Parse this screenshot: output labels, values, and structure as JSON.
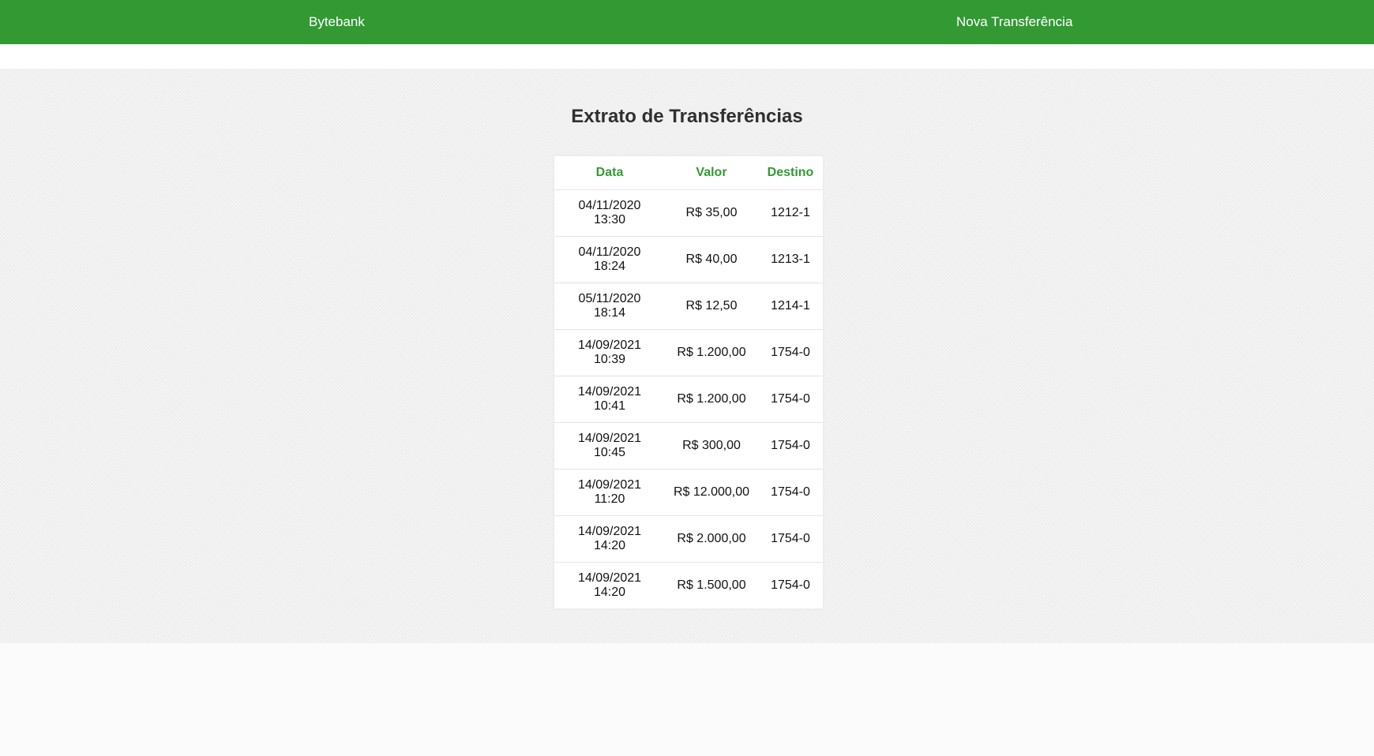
{
  "nav": {
    "brand": "Bytebank",
    "new_transfer": "Nova Transferência"
  },
  "colors": {
    "accent": "#339933",
    "nav_text": "#ffffff"
  },
  "page": {
    "title": "Extrato de Transferências"
  },
  "table": {
    "headers": [
      "Data",
      "Valor",
      "Destino"
    ],
    "rows": [
      {
        "date": "04/11/2020",
        "time": "13:30",
        "valor": "R$ 35,00",
        "destino": "1212-1"
      },
      {
        "date": "04/11/2020",
        "time": "18:24",
        "valor": "R$ 40,00",
        "destino": "1213-1"
      },
      {
        "date": "05/11/2020",
        "time": "18:14",
        "valor": "R$ 12,50",
        "destino": "1214-1"
      },
      {
        "date": "14/09/2021",
        "time": "10:39",
        "valor": "R$ 1.200,00",
        "destino": "1754-0"
      },
      {
        "date": "14/09/2021",
        "time": "10:41",
        "valor": "R$ 1.200,00",
        "destino": "1754-0"
      },
      {
        "date": "14/09/2021",
        "time": "10:45",
        "valor": "R$ 300,00",
        "destino": "1754-0"
      },
      {
        "date": "14/09/2021",
        "time": "11:20",
        "valor": "R$ 12.000,00",
        "destino": "1754-0"
      },
      {
        "date": "14/09/2021",
        "time": "14:20",
        "valor": "R$ 2.000,00",
        "destino": "1754-0"
      },
      {
        "date": "14/09/2021",
        "time": "14:20",
        "valor": "R$ 1.500,00",
        "destino": "1754-0"
      }
    ]
  }
}
